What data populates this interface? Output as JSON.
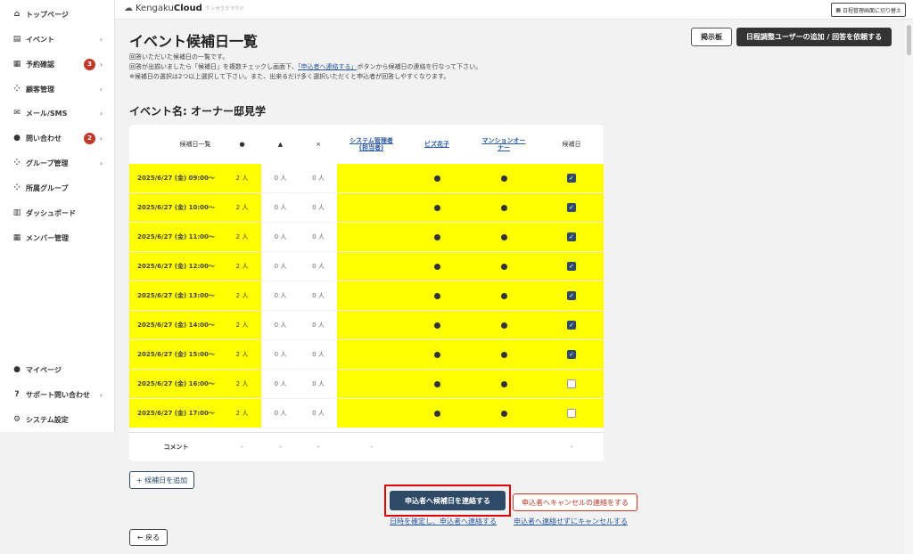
{
  "sidebar": {
    "items": [
      {
        "label": "トップページ",
        "icon": "home-icon",
        "glyph": "⌂",
        "has_chevron": false,
        "badge": ""
      },
      {
        "label": "イベント",
        "icon": "document-icon",
        "glyph": "▤",
        "has_chevron": true,
        "badge": ""
      },
      {
        "label": "予約確認",
        "icon": "calendar-icon",
        "glyph": "▦",
        "has_chevron": true,
        "badge": "3"
      },
      {
        "label": "顧客管理",
        "icon": "people-icon",
        "glyph": "⁘",
        "has_chevron": true,
        "badge": ""
      },
      {
        "label": "メール/SMS",
        "icon": "mail-icon",
        "glyph": "✉",
        "has_chevron": true,
        "badge": ""
      },
      {
        "label": "問い合わせ",
        "icon": "chat-icon",
        "glyph": "●",
        "has_chevron": true,
        "badge": "2"
      },
      {
        "label": "グループ管理",
        "icon": "group-icon",
        "glyph": "⁘",
        "has_chevron": true,
        "badge": ""
      },
      {
        "label": "所属グループ",
        "icon": "group-member-icon",
        "glyph": "⁘",
        "has_chevron": false,
        "badge": ""
      },
      {
        "label": "ダッシュボード",
        "icon": "dashboard-icon",
        "glyph": "▥",
        "has_chevron": false,
        "badge": ""
      },
      {
        "label": "メンバー管理",
        "icon": "grid-icon",
        "glyph": "▦",
        "has_chevron": false,
        "badge": ""
      }
    ],
    "bottom_items": [
      {
        "label": "マイページ",
        "icon": "user-icon",
        "glyph": "●",
        "has_chevron": false
      },
      {
        "label": "サポート問い合わせ",
        "icon": "help-icon",
        "glyph": "?",
        "has_chevron": true
      },
      {
        "label": "システム設定",
        "icon": "gear-icon",
        "glyph": "⚙",
        "has_chevron": false
      }
    ]
  },
  "header": {
    "logo_prefix": "Kengaku",
    "logo_bold": "Cloud",
    "logo_sub": "ケンガククラウド",
    "switch_label": "日程管理画面に切り替え"
  },
  "page": {
    "title": "イベント候補日一覧",
    "board_button": "掲示板",
    "invite_button": "日程調整ユーザーの追加 / 回答を依頼する",
    "desc1": "回答いただいた候補日の一覧です。",
    "desc2_pre": "回答が出揃いましたら「候補日」を複数チェックし画面下、",
    "desc2_link": "「申込者へ連絡する」",
    "desc2_post": "ボタンから候補日の連絡を行なって下さい。",
    "desc3": "※候補日の選択は2つ以上選択して下さい。また、出来るだけ多く選択いただくと申込者が回答しやすくなります。",
    "event_name": "イベント名: オーナー邸見学"
  },
  "table": {
    "headers": {
      "date": "候補日一覧",
      "circle": "●",
      "triangle": "▲",
      "cross": "×",
      "user1_line1": "システム管理者",
      "user1_line2": "(担当者)",
      "user2": "ビズ花子",
      "user3_line1": "マンションオー",
      "user3_line2": "ナー",
      "candidate": "候補日"
    },
    "rows": [
      {
        "date": "2025/6/27 (金) 09:00〜",
        "circle": "2 人",
        "triangle": "0 人",
        "cross": "0 人",
        "u1": "",
        "u2": true,
        "u3": true,
        "checked": true
      },
      {
        "date": "2025/6/27 (金) 10:00〜",
        "circle": "2 人",
        "triangle": "0 人",
        "cross": "0 人",
        "u1": "",
        "u2": true,
        "u3": true,
        "checked": true
      },
      {
        "date": "2025/6/27 (金) 11:00〜",
        "circle": "2 人",
        "triangle": "0 人",
        "cross": "0 人",
        "u1": "",
        "u2": true,
        "u3": true,
        "checked": true
      },
      {
        "date": "2025/6/27 (金) 12:00〜",
        "circle": "2 人",
        "triangle": "0 人",
        "cross": "0 人",
        "u1": "",
        "u2": true,
        "u3": true,
        "checked": true
      },
      {
        "date": "2025/6/27 (金) 13:00〜",
        "circle": "2 人",
        "triangle": "0 人",
        "cross": "0 人",
        "u1": "",
        "u2": true,
        "u3": true,
        "checked": true
      },
      {
        "date": "2025/6/27 (金) 14:00〜",
        "circle": "2 人",
        "triangle": "0 人",
        "cross": "0 人",
        "u1": "",
        "u2": true,
        "u3": true,
        "checked": true
      },
      {
        "date": "2025/6/27 (金) 15:00〜",
        "circle": "2 人",
        "triangle": "0 人",
        "cross": "0 人",
        "u1": "",
        "u2": true,
        "u3": true,
        "checked": true
      },
      {
        "date": "2025/6/27 (金) 16:00〜",
        "circle": "2 人",
        "triangle": "0 人",
        "cross": "0 人",
        "u1": "",
        "u2": true,
        "u3": true,
        "checked": false
      },
      {
        "date": "2025/6/27 (金) 17:00〜",
        "circle": "2 人",
        "triangle": "0 人",
        "cross": "0 人",
        "u1": "",
        "u2": true,
        "u3": true,
        "checked": false
      }
    ],
    "comment": {
      "label": "コメント",
      "circle": "-",
      "triangle": "-",
      "cross": "-",
      "u1": "-",
      "u2": "",
      "u3": "",
      "candidate": "-"
    }
  },
  "actions": {
    "add_date": "+ 候補日を追加",
    "contact": "申込者へ候補日を連絡する",
    "cancel_contact": "申込者へキャンセルの連絡をする",
    "confirm_link": "日時を確定し、申込者へ連絡する",
    "cancel_link": "申込者へ連絡せずにキャンセルする",
    "back": "← 戻る"
  },
  "colors": {
    "highlight_yellow": "#ffff00",
    "primary": "#2e4a67",
    "danger": "#c0392b",
    "annotation_red": "#e00000"
  }
}
